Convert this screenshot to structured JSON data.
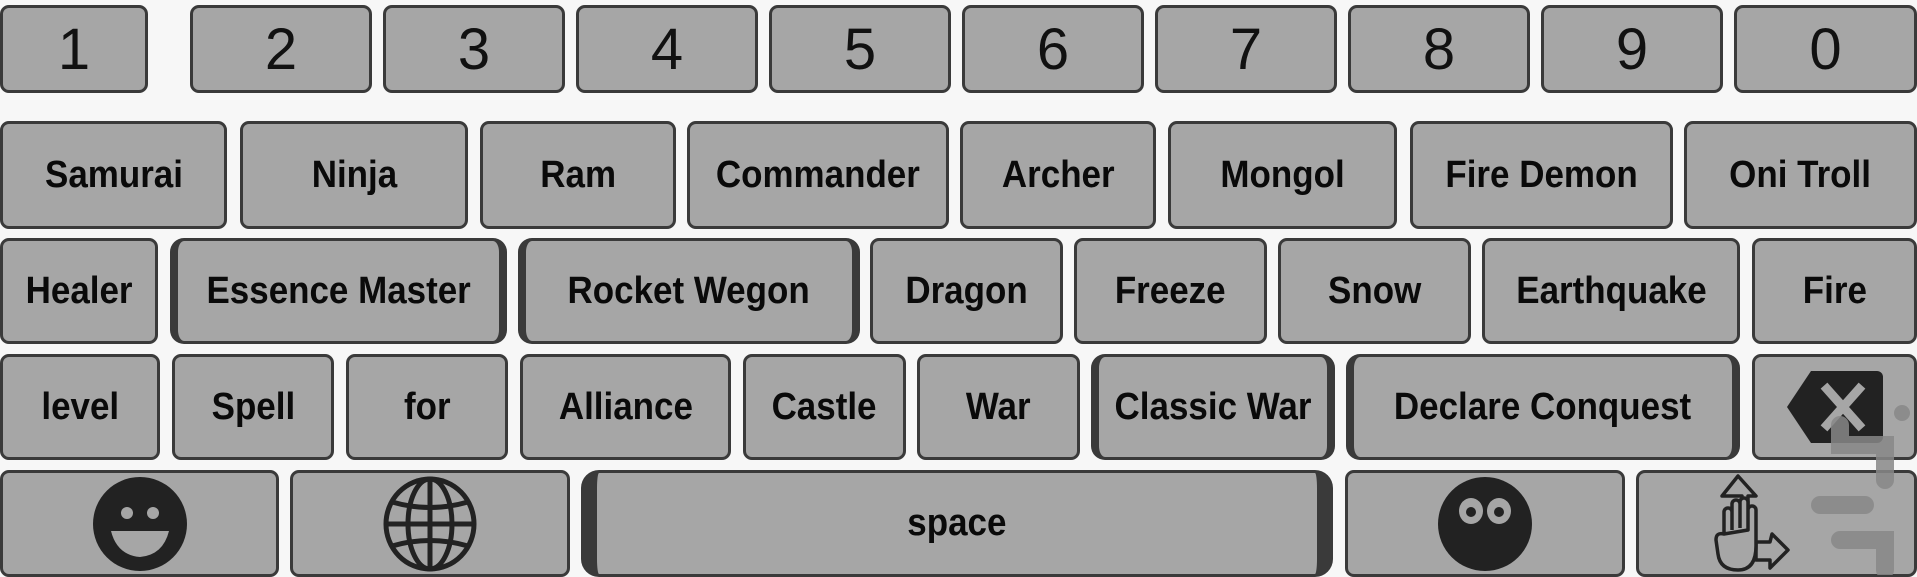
{
  "keyboard": {
    "row_numbers": [
      "1",
      "2",
      "3",
      "4",
      "5",
      "6",
      "7",
      "8",
      "9",
      "0"
    ],
    "row_units": [
      "Samurai",
      "Ninja",
      "Ram",
      "Commander",
      "Archer",
      "Mongol",
      "Fire Demon",
      "Oni Troll"
    ],
    "row_spells": [
      "Healer",
      "Essence Master",
      "Rocket Wegon",
      "Dragon",
      "Freeze",
      "Snow",
      "Earthquake",
      "Fire"
    ],
    "row_words": [
      "level",
      "Spell",
      "for",
      "Alliance",
      "Castle",
      "War",
      "Classic War",
      "Declare Conquest"
    ],
    "backspace_icon": "backspace-icon",
    "bottom": {
      "emoji_icon": "smiley-face-icon",
      "language_icon": "globe-icon",
      "space_label": "space",
      "sticker_icon": "eyes-face-icon",
      "gesture_icon": "hand-swipe-icon"
    }
  },
  "colors": {
    "key_fill": "#a6a6a6",
    "key_border": "#3a3a3a",
    "background": "#f7f7f7",
    "icon": "#222222"
  }
}
